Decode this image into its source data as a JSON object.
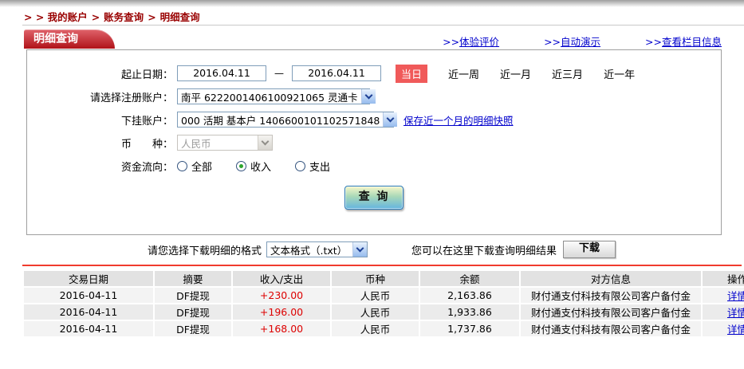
{
  "breadcrumb": {
    "prefix": "> >",
    "separator": ">",
    "items": [
      "我的账户",
      "账务查询",
      "明细查询"
    ]
  },
  "tab": {
    "title": "明细查询"
  },
  "top_links": [
    {
      "prefix": ">>",
      "label": "体验评价"
    },
    {
      "prefix": ">>",
      "label": "自动演示"
    },
    {
      "prefix": ">>",
      "label": "查看栏目信息"
    }
  ],
  "form": {
    "date_label": "起止日期：",
    "date_from": "2016.04.11",
    "date_to": "2016.04.11",
    "dash": "—",
    "today_button": "当日",
    "quick_ranges": [
      "近一周",
      "近一月",
      "近三月",
      "近一年"
    ],
    "account_label": "请选择注册账户：",
    "account_value": "南平 6222001406100921065 灵通卡",
    "sub_account_label": "下挂账户：",
    "sub_account_value": "000 活期 基本户 1406600101102571848",
    "snapshot_link": "保存近一个月的明细快照",
    "currency_label": "币　　种：",
    "currency_value": "人民币",
    "flow_label": "资金流向：",
    "flow_options": [
      {
        "label": "全部",
        "checked": false
      },
      {
        "label": "收入",
        "checked": true
      },
      {
        "label": "支出",
        "checked": false
      }
    ],
    "query_button": "查 询"
  },
  "download": {
    "format_label": "请您选择下载明细的格式",
    "format_value": "文本格式（.txt）",
    "hint": "您可以在这里下载查询明细结果",
    "button": "下载"
  },
  "table": {
    "headers": [
      "交易日期",
      "摘要",
      "收入/支出",
      "币种",
      "余额",
      "对方信息",
      "操作"
    ],
    "rows": [
      {
        "date": "2016-04-11",
        "summary": "DF提现",
        "amount": "+230.00",
        "currency": "人民币",
        "balance": "2,163.86",
        "counterparty": "财付通支付科技有限公司客户备付金",
        "action": "详情"
      },
      {
        "date": "2016-04-11",
        "summary": "DF提现",
        "amount": "+196.00",
        "currency": "人民币",
        "balance": "1,933.86",
        "counterparty": "财付通支付科技有限公司客户备付金",
        "action": "详情"
      },
      {
        "date": "2016-04-11",
        "summary": "DF提现",
        "amount": "+168.00",
        "currency": "人民币",
        "balance": "1,737.86",
        "counterparty": "财付通支付科技有限公司客户备付金",
        "action": "详情"
      }
    ]
  },
  "icons": {
    "dropdown_arrow": "chevron-down",
    "radio": "radio-circle"
  },
  "colors": {
    "brand_red": "#b01218",
    "breadcrumb_red": "#990000",
    "link_blue": "#0000cc",
    "today_red": "#f05a5a",
    "amount_red": "#dd0000",
    "select_border": "#7f9db9",
    "divider_red": "#f03b2d",
    "table_header_bg": "#e2e2e2",
    "row_bg": "#f3f3f3",
    "row_alt_bg": "#ebebeb"
  }
}
